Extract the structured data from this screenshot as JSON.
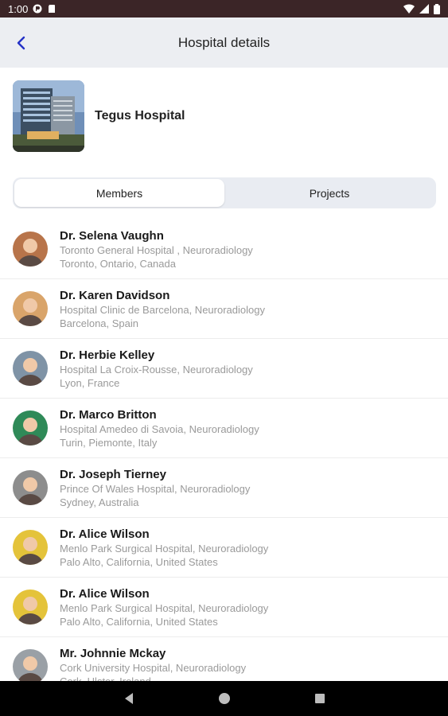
{
  "status_bar": {
    "time": "1:00"
  },
  "app_bar": {
    "title": "Hospital details"
  },
  "hospital": {
    "name": "Tegus Hospital"
  },
  "tabs": [
    {
      "label": "Members",
      "active": true
    },
    {
      "label": "Projects",
      "active": false
    }
  ],
  "members": [
    {
      "name": "Dr. Selena Vaughn",
      "hospital": "Toronto General Hospital , Neuroradiology",
      "location": "Toronto, Ontario, Canada",
      "avatar_color": "#b8744a"
    },
    {
      "name": "Dr. Karen Davidson",
      "hospital": "Hospital Clinic de Barcelona, Neuroradiology",
      "location": "Barcelona, Spain",
      "avatar_color": "#d9a46a"
    },
    {
      "name": "Dr. Herbie Kelley",
      "hospital": "Hospital La Croix-Rousse, Neuroradiology",
      "location": "Lyon, France",
      "avatar_color": "#7f93a6"
    },
    {
      "name": "Dr. Marco Britton",
      "hospital": "Hospital Amedeo di Savoia, Neuroradiology",
      "location": "Turin, Piemonte, Italy",
      "avatar_color": "#2f8a58"
    },
    {
      "name": "Dr. Joseph Tierney",
      "hospital": "Prince Of Wales Hospital, Neuroradiology",
      "location": "Sydney, Australia",
      "avatar_color": "#8d8d8d"
    },
    {
      "name": "Dr. Alice Wilson",
      "hospital": "Menlo Park Surgical Hospital, Neuroradiology",
      "location": "Palo Alto, California, United States",
      "avatar_color": "#e4c33a"
    },
    {
      "name": "Dr. Alice Wilson",
      "hospital": "Menlo Park Surgical Hospital, Neuroradiology",
      "location": "Palo Alto, California, United States",
      "avatar_color": "#e4c33a"
    },
    {
      "name": "Mr. Johnnie Mckay",
      "hospital": "Cork University Hospital, Neuroradiology",
      "location": "Cork, Ulster, Ireland",
      "avatar_color": "#9aa0a6"
    }
  ],
  "colors": {
    "status_bar": "#3b2527",
    "app_bar": "#eceef2",
    "accent": "#2432c6",
    "segment_bg": "#e9ecf2"
  },
  "icons": {
    "back": "chevron-left-icon",
    "nav_back": "triangle-back-icon",
    "nav_home": "circle-home-icon",
    "nav_recents": "square-recents-icon"
  }
}
